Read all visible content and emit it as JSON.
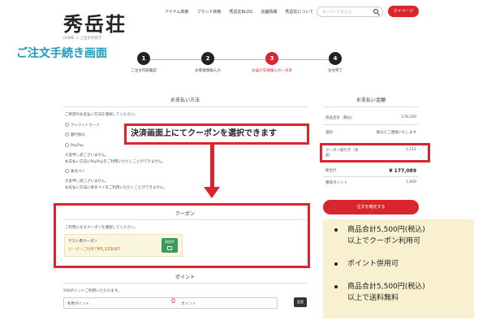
{
  "header": {
    "logo": "秀岳荘",
    "nav": [
      "アイテム検索",
      "ブランド検索",
      "秀岳荘BLOG",
      "店舗情報",
      "秀岳荘について"
    ],
    "search_placeholder": "キーワードを入力",
    "mypage": "マイページ"
  },
  "breadcrumb": "HOME > ご注文手続き",
  "page_heading": "ご注文手続き画面",
  "steps": [
    {
      "num": "1",
      "label": "ご注文内容確認"
    },
    {
      "num": "2",
      "label": "お客様情報入力"
    },
    {
      "num": "3",
      "label": "お届け先情報入力・決済"
    },
    {
      "num": "4",
      "label": "注文完了"
    }
  ],
  "payment": {
    "title": "お支払い方法",
    "prompt": "ご希望のお支払い方法を選択してください。",
    "options": [
      "クレジットカード",
      "銀行振込",
      "PayPay"
    ],
    "paypay_note1": "大変申し訳ございません。",
    "paypay_note2": "お支払い方法にPayPayをご利用いただくことができません。",
    "rakuten": "楽天ペイ",
    "rakuten_note1": "大変申し訳ございません。",
    "rakuten_note2": "お支払い方法に楽天ペイをご利用いただくことができません。"
  },
  "callout": "決済画面上にてクーポンを選択できます",
  "coupon": {
    "title": "クーポン",
    "prompt": "ご利用になるクーポンを選択してください。",
    "card_name": "テスト用クーポン",
    "card_desc_prefix": "クーポンご利用で",
    "card_amount": "¥1,111",
    "card_off": "OFF",
    "use_button": "利用中"
  },
  "points": {
    "title": "ポイント",
    "available": "500ポイントご利用いただけます。",
    "label": "利用ポイント",
    "value": "0",
    "unit": "ポイント",
    "change_button": "変更"
  },
  "summary": {
    "title": "お支払い金額",
    "subtotal_label": "商品合計（税込）",
    "subtotal_value": "178,200",
    "shipping_label": "送料",
    "shipping_value": "後ほどご連絡いたします",
    "coupon_label": "クーポン値引き（商品）",
    "coupon_value": "-1,111",
    "total_label": "総合計",
    "total_value": "¥ 177,089",
    "points_label": "獲得ポイント",
    "points_value": "1,609",
    "confirm_button": "注文を確定する"
  },
  "notes": [
    "商品合計5,500円(税込)\n以上でクーポン利用可",
    "ポイント併用可",
    "商品合計5,500円(税込)\n以上で送料無料"
  ]
}
